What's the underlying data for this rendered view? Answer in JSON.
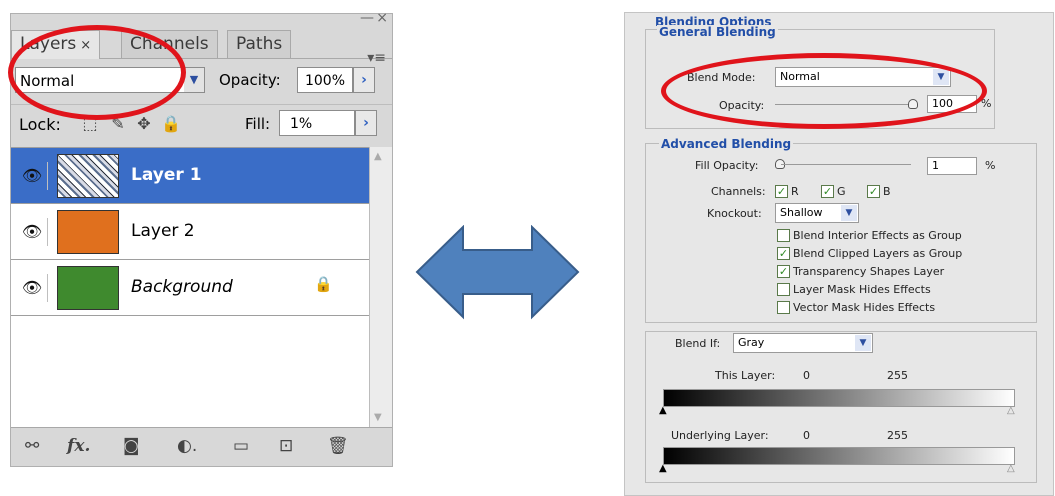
{
  "layers_panel": {
    "window_min": "—",
    "window_close": "×",
    "tabs": [
      {
        "label": "Layers",
        "close": "×"
      },
      {
        "label": "Channels"
      },
      {
        "label": "Paths"
      }
    ],
    "panel_menu_icon": "▾≡",
    "blend_mode": "Normal",
    "opacity_label": "Opacity:",
    "opacity_value": "100%",
    "lock_label": "Lock:",
    "fill_label": "Fill:",
    "fill_value": "1%",
    "layers": [
      {
        "name": "Layer 1",
        "selected": true,
        "thumb": "pattern"
      },
      {
        "name": "Layer 2",
        "selected": false,
        "thumb": "orange"
      },
      {
        "name": "Background",
        "selected": false,
        "thumb": "green",
        "locked": true
      }
    ],
    "bottom_icons": [
      "link-icon",
      "fx-icon",
      "mask-icon",
      "adjustment-icon",
      "group-folder-icon",
      "new-layer-icon",
      "trash-icon"
    ],
    "fx_label": "fx."
  },
  "blending_options": {
    "title": "Blending Options",
    "general": {
      "title": "General Blending",
      "blend_mode_label": "Blend Mode:",
      "blend_mode_value": "Normal",
      "opacity_label": "Opacity:",
      "opacity_value": "100",
      "opacity_unit": "%"
    },
    "advanced": {
      "title": "Advanced Blending",
      "fill_opacity_label": "Fill Opacity:",
      "fill_opacity_value": "1",
      "fill_opacity_unit": "%",
      "channels_label": "Channels:",
      "channels": [
        {
          "label": "R",
          "checked": true
        },
        {
          "label": "G",
          "checked": true
        },
        {
          "label": "B",
          "checked": true
        }
      ],
      "knockout_label": "Knockout:",
      "knockout_value": "Shallow",
      "options": [
        {
          "label": "Blend Interior Effects as Group",
          "checked": false
        },
        {
          "label": "Blend Clipped Layers as Group",
          "checked": true
        },
        {
          "label": "Transparency Shapes Layer",
          "checked": true
        },
        {
          "label": "Layer Mask Hides Effects",
          "checked": false
        },
        {
          "label": "Vector Mask Hides Effects",
          "checked": false
        }
      ]
    },
    "blend_if": {
      "label": "Blend If:",
      "value": "Gray",
      "this_layer_label": "This Layer:",
      "this_layer_min": "0",
      "this_layer_max": "255",
      "underlying_label": "Underlying Layer:",
      "underlying_min": "0",
      "underlying_max": "255"
    }
  },
  "colors": {
    "highlight_red": "#e0141b",
    "arrow_fill": "#4f81bd",
    "arrow_stroke": "#385d8a",
    "selected_layer": "#3a6dc7",
    "section_title": "#224fa8"
  }
}
